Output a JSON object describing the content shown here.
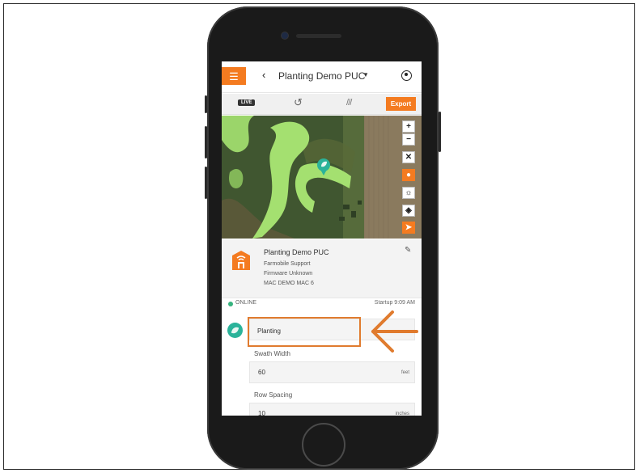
{
  "header": {
    "title": "Planting Demo PUC",
    "menu_icon": "hamburger-menu-icon",
    "back_icon": "chevron-left-icon",
    "dropdown_icon": "caret-down-icon",
    "account_icon": "user-account-icon"
  },
  "tabs": {
    "live": "LIVE",
    "history_icon": "history-icon",
    "coverage_icon": "hatch-layer-icon",
    "export": "Export"
  },
  "map": {
    "controls": [
      "+",
      "−"
    ]
  },
  "device": {
    "name": "Planting Demo PUC",
    "owner": "Farmobile Support",
    "firmware": "Firmware Unknown",
    "mac": "MAC DEMO MAC 6"
  },
  "status": {
    "state": "ONLINE",
    "startup": "Startup 9:09 AM"
  },
  "operation": {
    "type": "Planting",
    "swath_label": "Swath Width",
    "swath_value": "60",
    "swath_unit": "feet",
    "row_label": "Row Spacing",
    "row_value": "10",
    "row_unit": "inches"
  },
  "colors": {
    "accent": "#f47b20",
    "online": "#36b37e",
    "operation_icon": "#2bb39a",
    "annotation": "#e07b2e"
  }
}
